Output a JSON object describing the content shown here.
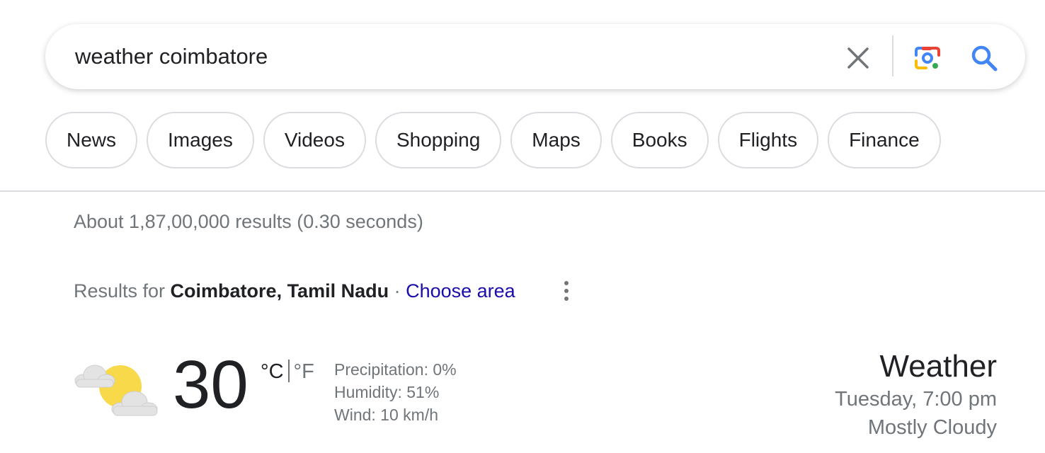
{
  "search": {
    "query": "weather coimbatore"
  },
  "chips": [
    {
      "label": "News"
    },
    {
      "label": "Images"
    },
    {
      "label": "Videos"
    },
    {
      "label": "Shopping"
    },
    {
      "label": "Maps"
    },
    {
      "label": "Books"
    },
    {
      "label": "Flights"
    },
    {
      "label": "Finance"
    }
  ],
  "result_stats": "About 1,87,00,000 results (0.30 seconds)",
  "location": {
    "prefix": "Results for ",
    "place": "Coimbatore, Tamil Nadu",
    "separator": " · ",
    "choose_area": "Choose area"
  },
  "weather": {
    "temperature": "30",
    "unit_c": "°C",
    "unit_f": "°F",
    "precipitation": "Precipitation: 0%",
    "humidity": "Humidity: 51%",
    "wind": "Wind: 10 km/h",
    "title": "Weather",
    "datetime": "Tuesday, 7:00 pm",
    "condition": "Mostly Cloudy",
    "icon": "partly-cloudy-icon"
  },
  "colors": {
    "link": "#1a0dab",
    "secondary_text": "#70757a",
    "border": "#dadce0",
    "search_blue": "#4285f4"
  }
}
